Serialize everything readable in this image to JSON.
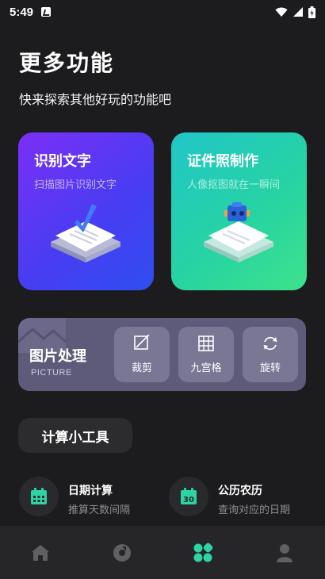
{
  "status": {
    "time": "5:49"
  },
  "header": {
    "title": "更多功能",
    "subtitle": "快来探索其他好玩的功能吧"
  },
  "cards": [
    {
      "title": "识别文字",
      "subtitle": "扫描图片识别文字"
    },
    {
      "title": "证件照制作",
      "subtitle": "人像抠图就在一瞬间"
    }
  ],
  "photo_panel": {
    "title": "图片处理",
    "subtitle": "PICTURE",
    "tools": [
      {
        "label": "裁剪",
        "icon": "crop-icon"
      },
      {
        "label": "九宫格",
        "icon": "grid-icon"
      },
      {
        "label": "旋转",
        "icon": "rotate-icon"
      }
    ]
  },
  "calc_section": {
    "label": "计算小工具"
  },
  "calc_tools": [
    {
      "title": "日期计算",
      "subtitle": "推算天数间隔",
      "icon": "calendar-icon"
    },
    {
      "title": "公历农历",
      "subtitle": "查询对应的日期",
      "icon": "calendar-30-icon",
      "icon_text": "30"
    }
  ],
  "tab_bar": {
    "items": [
      "home-icon",
      "music-disc-icon",
      "apps-grid-icon",
      "profile-icon"
    ],
    "active_index": 2,
    "active_color": "#2ed3a6",
    "inactive_color": "#5f5f64"
  },
  "colors": {
    "background": "#1c1c1e",
    "accent": "#2ed3a6",
    "ocr_card": "#5a35f4",
    "id_card": "#26d3a3",
    "photo_panel": "#5d5a7a"
  }
}
